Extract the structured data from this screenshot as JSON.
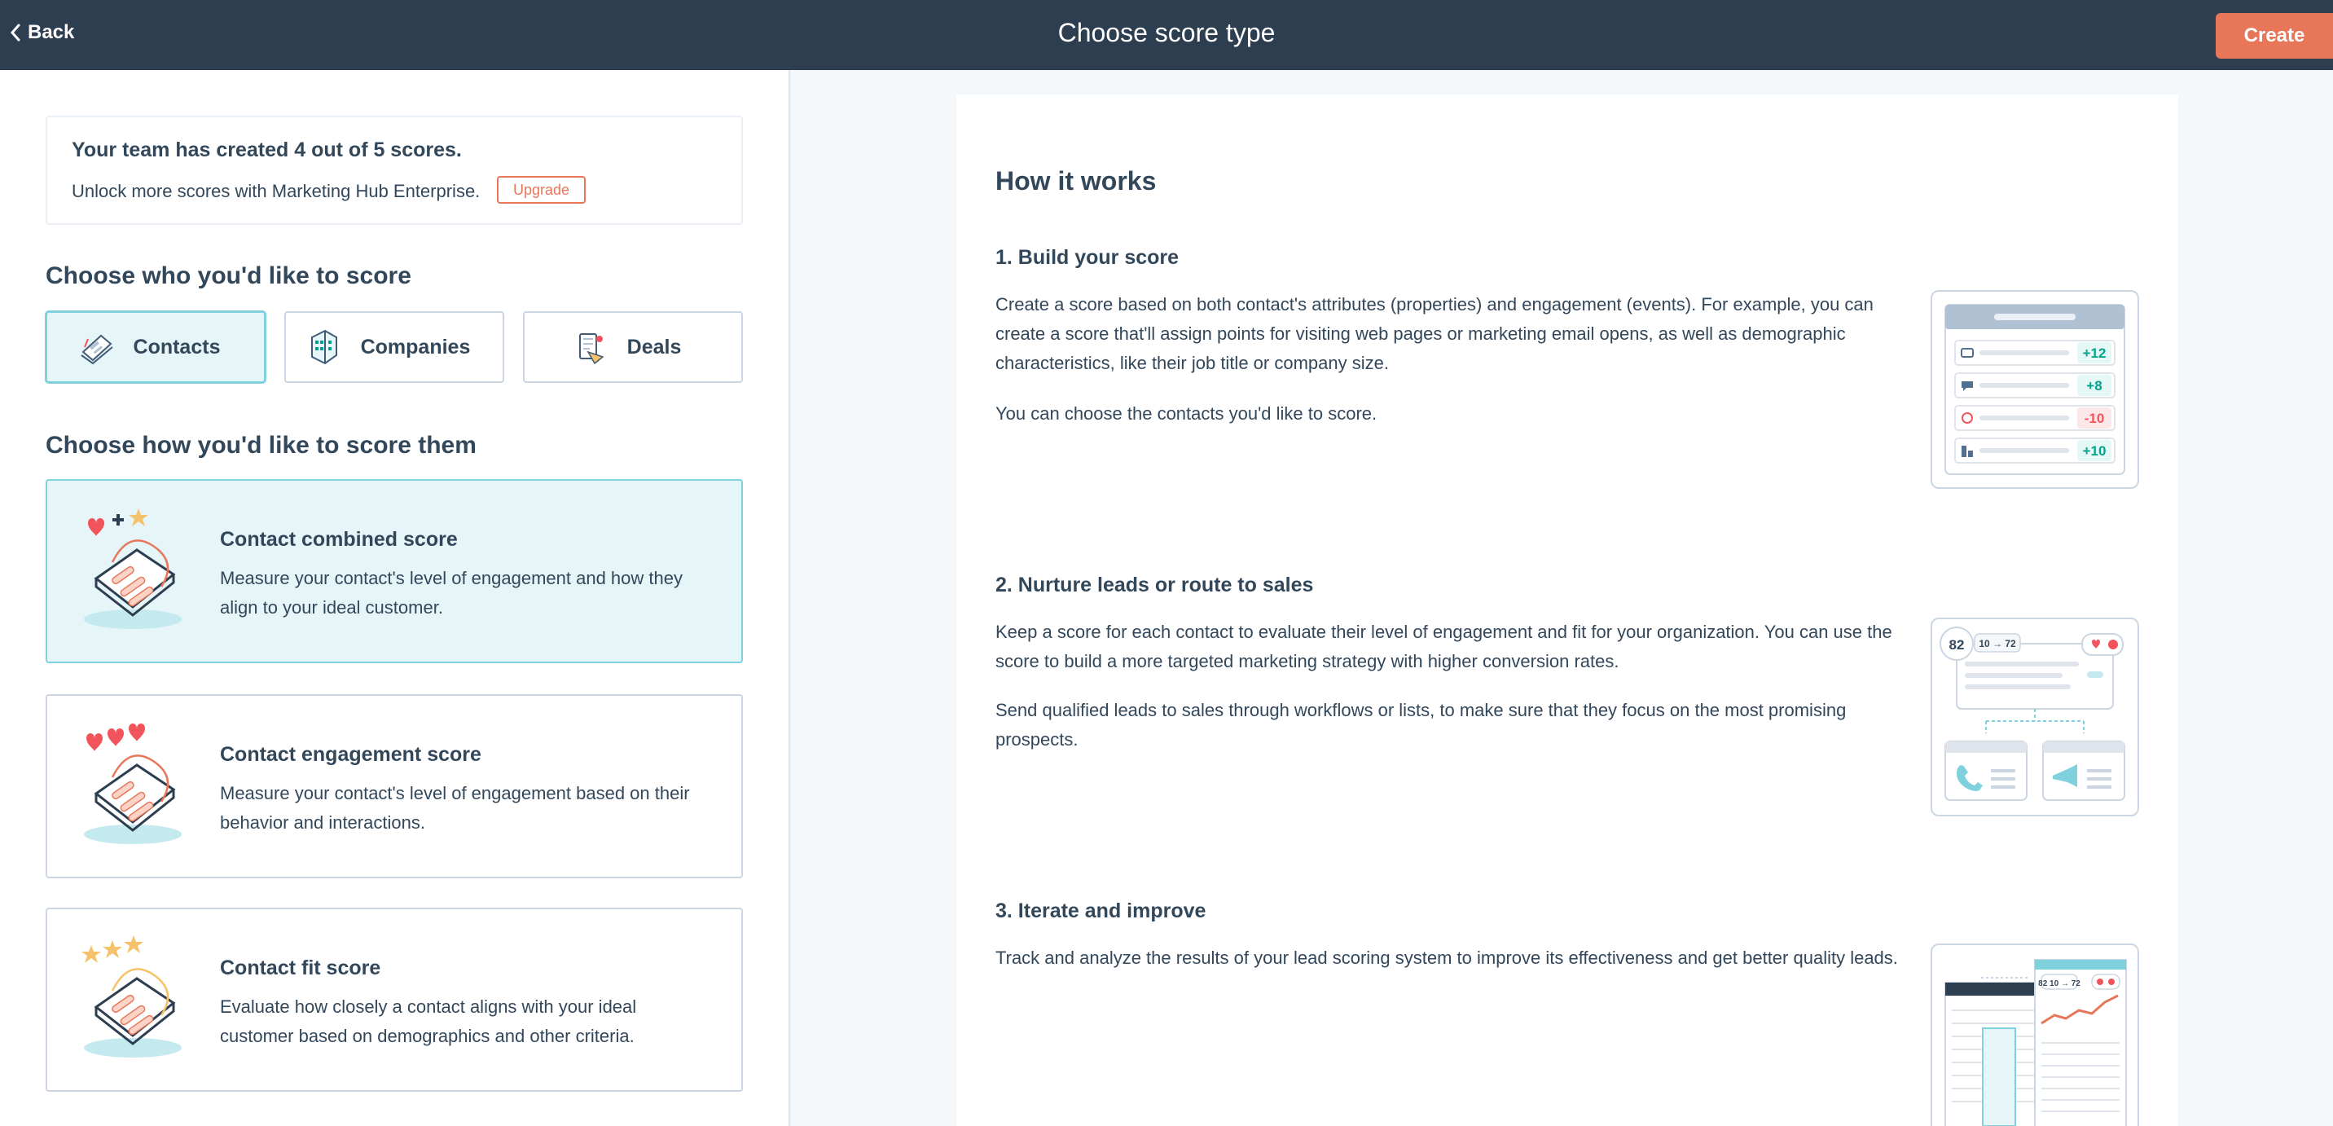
{
  "header": {
    "back_label": "Back",
    "title": "Choose score type",
    "create_label": "Create"
  },
  "limit_notice": {
    "title": "Your team has created 4 out of 5 scores.",
    "text": "Unlock more scores with Marketing Hub Enterprise.",
    "upgrade_label": "Upgrade"
  },
  "who": {
    "title": "Choose who you'd like to score",
    "options": [
      {
        "label": "Contacts",
        "icon": "contacts-icon",
        "selected": true
      },
      {
        "label": "Companies",
        "icon": "companies-icon",
        "selected": false
      },
      {
        "label": "Deals",
        "icon": "deals-icon",
        "selected": false
      }
    ]
  },
  "how": {
    "title": "Choose how you'd like to score them",
    "cards": [
      {
        "title": "Contact combined score",
        "description": "Measure your contact's level of engagement and how they align to your ideal customer.",
        "selected": true
      },
      {
        "title": "Contact engagement score",
        "description": "Measure your contact's level of engagement based on their behavior and interactions.",
        "selected": false
      },
      {
        "title": "Contact fit score",
        "description": "Evaluate how closely a contact aligns with your ideal customer based on demographics and other criteria.",
        "selected": false
      }
    ]
  },
  "how_it_works": {
    "title": "How it works",
    "steps": [
      {
        "title": "1. Build your score",
        "paragraphs": [
          "Create a score based on both contact's attributes (properties) and engagement (events). For example, you can create a score that'll assign points for visiting web pages or marketing email opens, as well as demographic characteristics, like their job title or company size.",
          "You can choose the contacts you'd like to score."
        ],
        "badges": [
          "+12",
          "+8",
          "-10",
          "+10"
        ]
      },
      {
        "title": "2. Nurture leads or route to sales",
        "paragraphs": [
          "Keep a score for each contact to evaluate their level of engagement and fit for your organization. You can use the score to build a more targeted marketing strategy with higher conversion rates.",
          "Send qualified leads to sales through workflows or lists, to make sure that they focus on the most promising prospects."
        ],
        "score": "82",
        "range": "10 → 72"
      },
      {
        "title": "3. Iterate and improve",
        "paragraphs": [
          "Track and analyze the results of your lead scoring system to improve its effectiveness and get better quality leads."
        ],
        "score": "82",
        "range": "10 → 72"
      }
    ]
  },
  "colors": {
    "header_bg": "#2d3e50",
    "accent": "#e8775a",
    "selected_bg": "#e5f5f8",
    "selected_border": "#7fd1de",
    "positive": "#00a38d",
    "negative": "#f2545b"
  }
}
